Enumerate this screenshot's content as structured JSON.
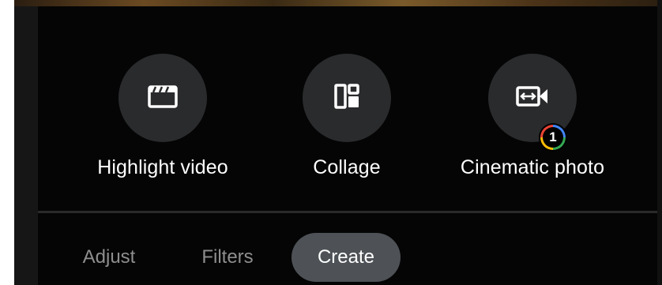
{
  "tools": [
    {
      "label": "Highlight video",
      "icon": "clapperboard-icon"
    },
    {
      "label": "Collage",
      "icon": "collage-icon"
    },
    {
      "label": "Cinematic photo",
      "icon": "cinematic-icon",
      "badge": "1"
    }
  ],
  "tabs": [
    {
      "label": "Adjust",
      "active": false
    },
    {
      "label": "Filters",
      "active": false
    },
    {
      "label": "Create",
      "active": true
    }
  ],
  "colors": {
    "background": "#000000",
    "tool_circle": "#2a2b2d",
    "active_tab": "#4e5257",
    "inactive_text": "#8e8e8e"
  }
}
